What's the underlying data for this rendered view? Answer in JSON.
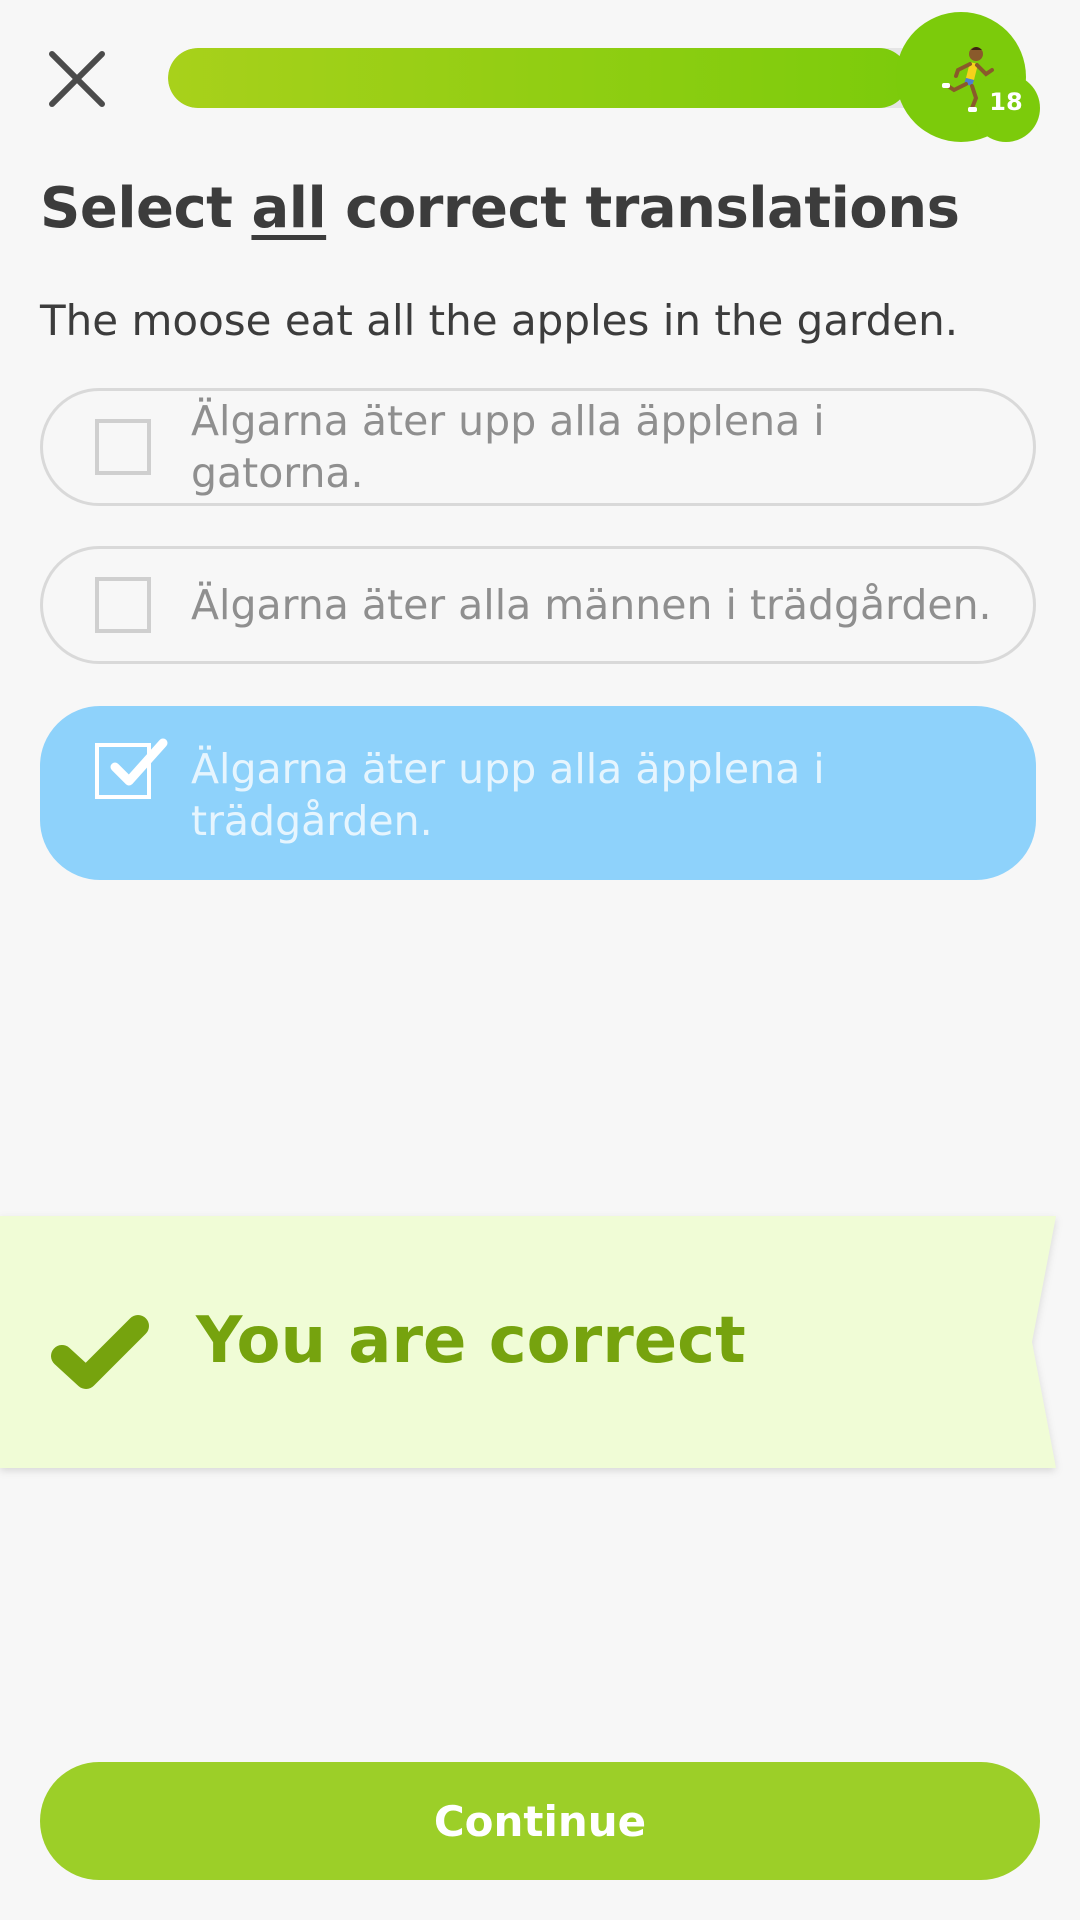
{
  "header": {
    "progress_fraction": 0.95,
    "streak_count": "18",
    "icons": {
      "close": "close-icon",
      "runner": "runner-icon"
    }
  },
  "exercise": {
    "title_before": "Select ",
    "title_emphasis": "all",
    "title_after": " correct translations",
    "prompt": "The moose eat all the apples in the garden.",
    "options": [
      {
        "text": "Älgarna äter upp alla äpplena i gatorna.",
        "checked": false
      },
      {
        "text": "Älgarna äter alla männen i trädgården.",
        "checked": false
      },
      {
        "text": "Älgarna äter upp alla äpplena i trädgården.",
        "checked": true
      }
    ]
  },
  "feedback": {
    "message": "You are correct",
    "icon": "checkmark-icon"
  },
  "footer": {
    "continue_label": "Continue"
  },
  "colors": {
    "progress_start": "#a8d11b",
    "progress_end": "#7ccb0b",
    "selected_option": "#8ed2fb",
    "banner_background": "#f0fcd6",
    "banner_text": "#76a30e",
    "continue_button": "#9ccf28"
  }
}
